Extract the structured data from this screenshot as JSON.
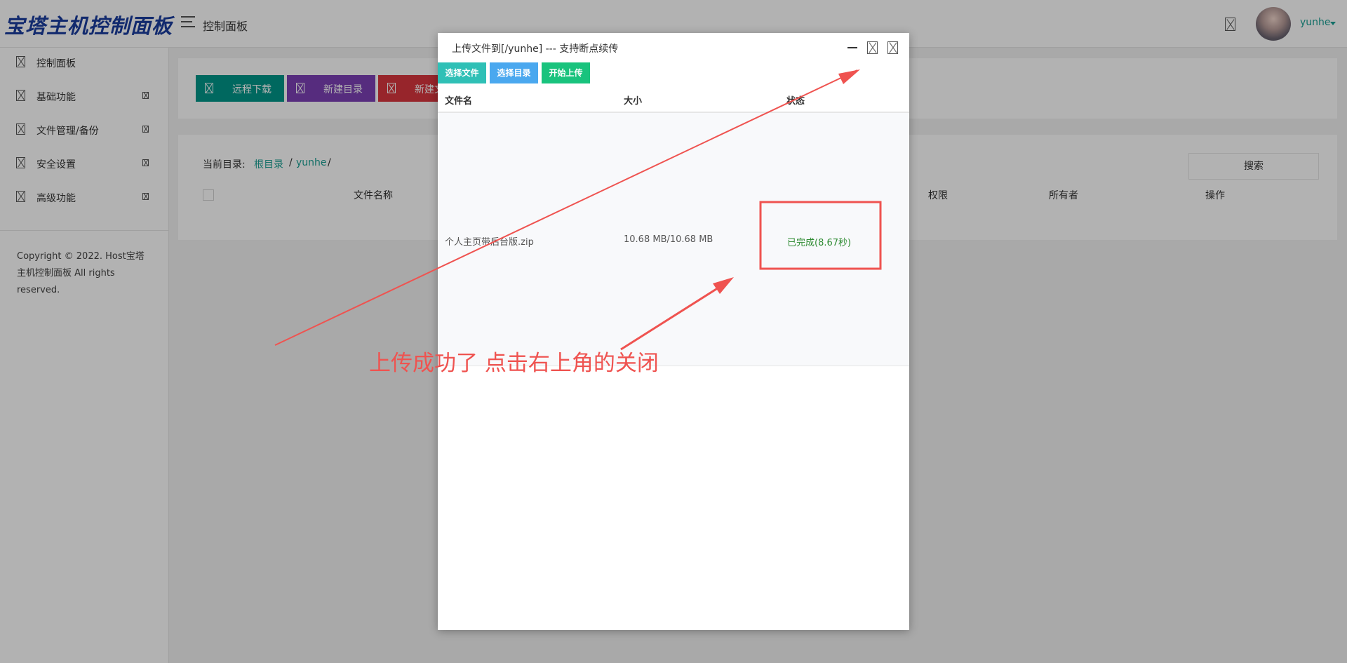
{
  "header": {
    "brand": "宝塔主机控制面板",
    "title": "控制面板",
    "username": "yunhe"
  },
  "sidebar": {
    "items": [
      {
        "label": "控制面板"
      },
      {
        "label": "基础功能"
      },
      {
        "label": "文件管理/备份"
      },
      {
        "label": "安全设置"
      },
      {
        "label": "高级功能"
      }
    ],
    "copyright": "Copyright © 2022. Host宝塔主机控制面板 All rights reserved."
  },
  "toolbar": {
    "buttons": [
      {
        "label": "远程下载",
        "color": "#009688"
      },
      {
        "label": "新建目录",
        "color": "#7b3fb5"
      },
      {
        "label": "新建文件",
        "color": "#d9363e"
      }
    ]
  },
  "files": {
    "path_label": "当前目录:",
    "path_root": "根目录",
    "path_sep": "/",
    "path_dir": "yunhe",
    "search_label": "搜索",
    "columns": [
      "文件名称",
      "权限",
      "所有者",
      "操作"
    ]
  },
  "modal": {
    "title": "上传文件到[/yunhe] --- 支持断点续传",
    "buttons": [
      {
        "label": "选择文件",
        "color": "#2fc0b6"
      },
      {
        "label": "选择目录",
        "color": "#4aa8ef"
      },
      {
        "label": "开始上传",
        "color": "#19c37d"
      }
    ],
    "columns": {
      "name": "文件名",
      "size": "大小",
      "status": "状态"
    },
    "rows": [
      {
        "name": "个人主页带后台版.zip",
        "size": "10.68 MB/10.68 MB",
        "status": "已完成(8.67秒)"
      }
    ]
  },
  "annotation": {
    "text": "上传成功了 点击右上角的关闭",
    "color": "#ef5350"
  }
}
